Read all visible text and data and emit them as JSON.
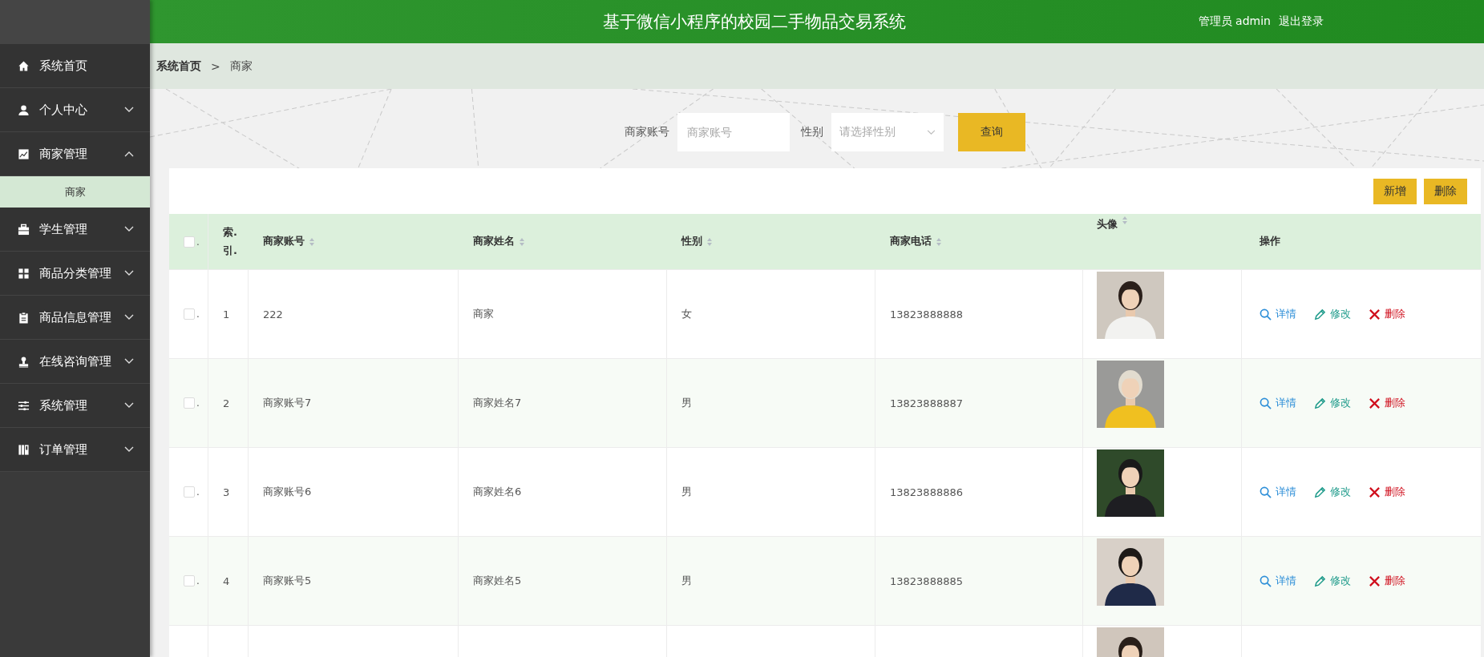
{
  "sidebar": {
    "items": [
      {
        "kind": "home",
        "label": "系统首页"
      },
      {
        "kind": "user",
        "label": "个人中心",
        "expanded": false
      },
      {
        "kind": "chart",
        "label": "商家管理",
        "expanded": true,
        "children": [
          {
            "label": "商家",
            "selected": true
          }
        ]
      },
      {
        "kind": "case",
        "label": "学生管理",
        "expanded": false
      },
      {
        "kind": "grid",
        "label": "商品分类管理",
        "expanded": false
      },
      {
        "kind": "clipboard",
        "label": "商品信息管理",
        "expanded": false
      },
      {
        "kind": "stamp",
        "label": "在线咨询管理",
        "expanded": false
      },
      {
        "kind": "sliders",
        "label": "系统管理",
        "expanded": false
      },
      {
        "kind": "books",
        "label": "订单管理",
        "expanded": false
      }
    ]
  },
  "header": {
    "title": "基于微信小程序的校园二手物品交易系统",
    "user": "管理员 admin",
    "logout": "退出登录"
  },
  "breadcrumb": {
    "items": [
      "系统首页",
      "商家"
    ],
    "separator": ">"
  },
  "search": {
    "fields": [
      {
        "kind": "text",
        "label": "商家账号",
        "placeholder": "商家账号"
      },
      {
        "kind": "select",
        "label": "性别",
        "placeholder": "请选择性别"
      }
    ],
    "button": "查询"
  },
  "toolbar": {
    "buttons": [
      "新增",
      "删除"
    ]
  },
  "table": {
    "select_all": {
      "checked": false,
      "label": "."
    },
    "columns": [
      {
        "label": "索.\n引.",
        "sortable": false
      },
      {
        "label": "商家账号",
        "sortable": true
      },
      {
        "label": "商家姓名",
        "sortable": true
      },
      {
        "label": "性别",
        "sortable": true
      },
      {
        "label": "商家电话",
        "sortable": true
      },
      {
        "label": "头像",
        "sortable": true
      },
      {
        "label": "操作",
        "sortable": false
      }
    ],
    "rows": [
      {
        "checked": false,
        "label": ".",
        "index": "1",
        "account": "222",
        "name": "商家",
        "gender": "女",
        "phone": "13823888888",
        "avatar": {
          "kind": "picture"
        },
        "actions": [
          {
            "kind": "detail",
            "label": "详情"
          },
          {
            "kind": "edit",
            "label": "修改"
          },
          {
            "kind": "delete",
            "label": "删除"
          }
        ]
      },
      {
        "checked": false,
        "label": ".",
        "index": "2",
        "account": "商家账号7",
        "name": "商家姓名7",
        "gender": "男",
        "phone": "13823888887",
        "avatar": {
          "kind": "picture"
        },
        "actions": [
          {
            "kind": "detail",
            "label": "详情"
          },
          {
            "kind": "edit",
            "label": "修改"
          },
          {
            "kind": "delete",
            "label": "删除"
          }
        ]
      },
      {
        "checked": false,
        "label": ".",
        "index": "3",
        "account": "商家账号6",
        "name": "商家姓名6",
        "gender": "男",
        "phone": "13823888886",
        "avatar": {
          "kind": "picture"
        },
        "actions": [
          {
            "kind": "detail",
            "label": "详情"
          },
          {
            "kind": "edit",
            "label": "修改"
          },
          {
            "kind": "delete",
            "label": "删除"
          }
        ]
      },
      {
        "checked": false,
        "label": ".",
        "index": "4",
        "account": "商家账号5",
        "name": "商家姓名5",
        "gender": "男",
        "phone": "13823888885",
        "avatar": {
          "kind": "picture"
        },
        "actions": [
          {
            "kind": "detail",
            "label": "详情"
          },
          {
            "kind": "edit",
            "label": "修改"
          },
          {
            "kind": "delete",
            "label": "删除"
          }
        ]
      },
      {
        "avatar": {
          "kind": "picture"
        }
      }
    ]
  }
}
